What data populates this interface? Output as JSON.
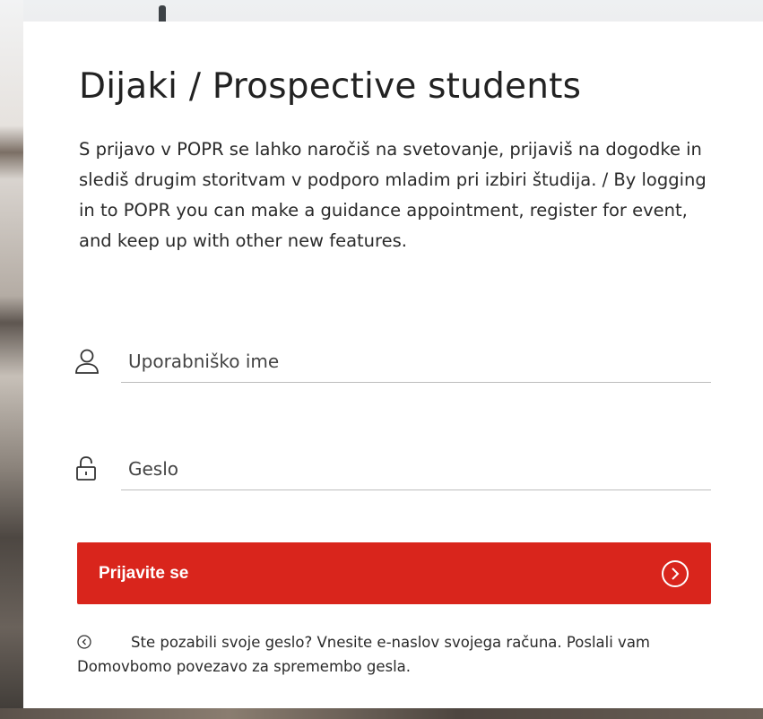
{
  "page": {
    "title": "Dijaki / Prospective students",
    "intro": "S prijavo v POPR se lahko naročiš na svetovanje, prijaviš na dogodke in slediš drugim storitvam v podporo mladim pri izbiri študija. / By logging in to POPR you can make a guidance appointment, register for event, and keep up with other new features."
  },
  "form": {
    "username": {
      "placeholder": "Uporabniško ime",
      "value": "",
      "icon": "user-icon"
    },
    "password": {
      "placeholder": "Geslo",
      "value": "",
      "icon": "lock-icon"
    },
    "submit": {
      "label": "Prijavite se",
      "icon": "arrow-right-circle-icon"
    }
  },
  "forgot": {
    "icon": "back-circle-icon",
    "text": "Ste pozabili svoje geslo? Vnesite e-naslov svojega računa. Poslali vam",
    "link": "Domovbomo povezavo za spremembo gesla."
  },
  "colors": {
    "accent": "#d9251c",
    "text": "#222222",
    "underline": "#bdbdbd",
    "card": "#ffffff"
  }
}
